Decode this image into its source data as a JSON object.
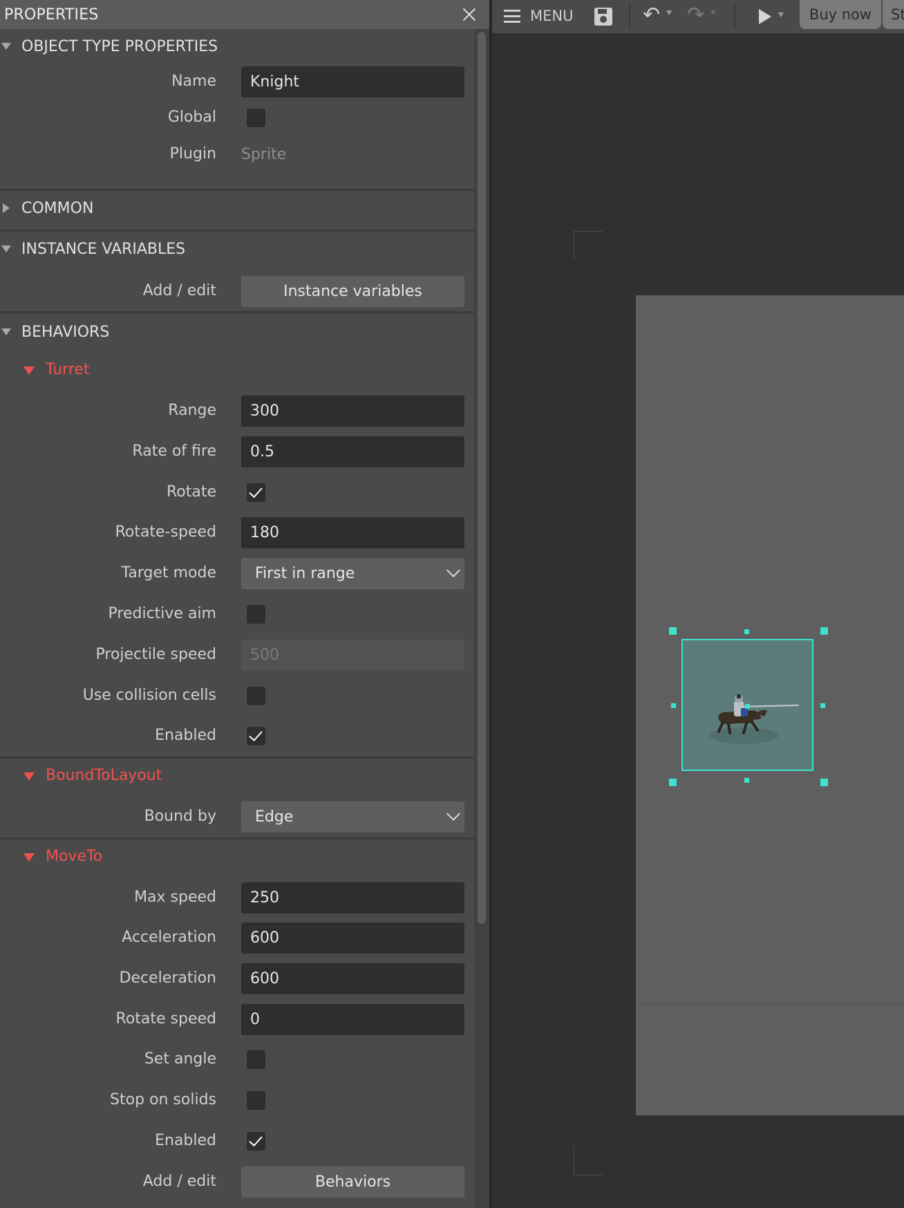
{
  "panel": {
    "title": "PROPERTIES",
    "sections": {
      "object_type": "OBJECT TYPE PROPERTIES",
      "common": "COMMON",
      "instance_variables": "INSTANCE VARIABLES",
      "behaviors": "BEHAVIORS"
    },
    "object": {
      "name_label": "Name",
      "name_value": "Knight",
      "global_label": "Global",
      "global_checked": false,
      "plugin_label": "Plugin",
      "plugin_value": "Sprite"
    },
    "instance_variables": {
      "add_edit_label": "Add / edit",
      "button_label": "Instance variables"
    },
    "turret": {
      "title": "Turret",
      "range_label": "Range",
      "range_value": "300",
      "rate_label": "Rate of fire",
      "rate_value": "0.5",
      "rotate_label": "Rotate",
      "rotate_checked": true,
      "rotate_speed_label": "Rotate-speed",
      "rotate_speed_value": "180",
      "target_mode_label": "Target mode",
      "target_mode_value": "First in range",
      "predictive_label": "Predictive aim",
      "predictive_checked": false,
      "projectile_label": "Projectile speed",
      "projectile_value": "500",
      "collision_label": "Use collision cells",
      "collision_checked": false,
      "enabled_label": "Enabled",
      "enabled_checked": true
    },
    "bound": {
      "title": "BoundToLayout",
      "bound_by_label": "Bound by",
      "bound_by_value": "Edge"
    },
    "moveto": {
      "title": "MoveTo",
      "max_speed_label": "Max speed",
      "max_speed_value": "250",
      "accel_label": "Acceleration",
      "accel_value": "600",
      "decel_label": "Deceleration",
      "decel_value": "600",
      "rotate_speed_label": "Rotate speed",
      "rotate_speed_value": "0",
      "set_angle_label": "Set angle",
      "set_angle_checked": false,
      "stop_solids_label": "Stop on solids",
      "stop_solids_checked": false,
      "enabled_label": "Enabled",
      "enabled_checked": true
    },
    "behaviors_footer": {
      "add_edit_label": "Add / edit",
      "button_label": "Behaviors"
    }
  },
  "toolbar": {
    "menu_label": "MENU",
    "undo_icon": "↶",
    "redo_icon": "↷",
    "buy_label": "Buy now",
    "store_label": "St"
  },
  "colors": {
    "accent": "#3fe2cf",
    "behavior_title": "#ef5350"
  }
}
